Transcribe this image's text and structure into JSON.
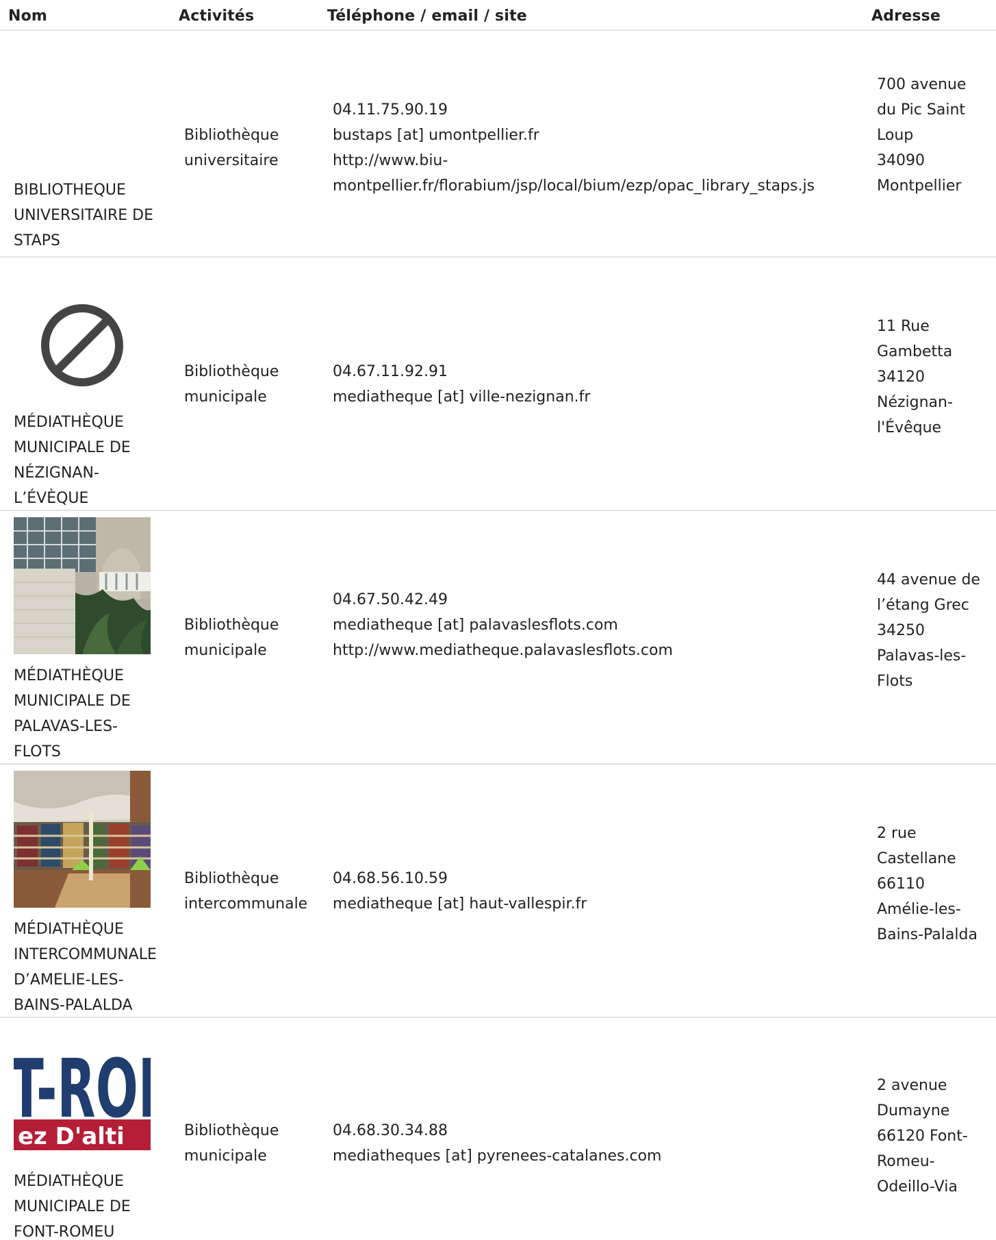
{
  "headers": {
    "nom": "Nom",
    "activites": "Activités",
    "contact": "Téléphone / email / site",
    "adresse": "Adresse"
  },
  "rows": [
    {
      "name_lines": [
        "BIBLIOTHEQUE",
        "UNIVERSITAIRE DE",
        "STAPS"
      ],
      "activity_lines": [
        "Bibliothèque",
        "universitaire"
      ],
      "contact_lines": [
        "04.11.75.90.19",
        "bustaps [at] umontpellier.fr",
        "http://www.biu-",
        "montpellier.fr/florabium/jsp/local/bium/ezp/opac_library_staps.js"
      ],
      "address_lines": [
        "700 avenue",
        "du Pic Saint",
        "Loup",
        "34090",
        "Montpellier"
      ],
      "image": "none"
    },
    {
      "name_lines": [
        "MÉDIATHÈQUE",
        "MUNICIPALE DE",
        "NÉZIGNAN-",
        "L’ÉVÈQUE"
      ],
      "activity_lines": [
        "Bibliothèque",
        "municipale"
      ],
      "contact_lines": [
        "04.67.11.92.91",
        "mediatheque [at] ville-nezignan.fr"
      ],
      "address_lines": [
        "11 Rue",
        "Gambetta",
        "34120",
        "Nézignan-",
        "l'Évêque"
      ],
      "image": "no-image-icon"
    },
    {
      "name_lines": [
        "MÉDIATHÈQUE",
        "MUNICIPALE DE",
        "PALAVAS-LES-",
        "FLOTS"
      ],
      "activity_lines": [
        "Bibliothèque",
        "municipale"
      ],
      "contact_lines": [
        "04.67.50.42.49",
        "mediatheque [at] palavaslesflots.com",
        "http://www.mediatheque.palavaslesflots.com"
      ],
      "address_lines": [
        "44 avenue de",
        "l’étang Grec",
        "34250",
        "Palavas-les-",
        "Flots"
      ],
      "image": "building-photo"
    },
    {
      "name_lines": [
        "MÉDIATHÈQUE",
        "INTERCOMMUNALE",
        "D’AMELIE-LES-",
        "BAINS-PALALDA"
      ],
      "activity_lines": [
        "Bibliothèque",
        "intercommunale"
      ],
      "contact_lines": [
        "04.68.56.10.59",
        "mediatheque [at] haut-vallespir.fr"
      ],
      "address_lines": [
        "2 rue",
        "Castellane",
        "66110",
        "Amélie-les-",
        "Bains-Palalda"
      ],
      "image": "library-interior-photo"
    },
    {
      "name_lines": [
        "MÉDIATHÈQUE",
        "MUNICIPALE DE",
        "FONT-ROMEU"
      ],
      "activity_lines": [
        "Bibliothèque",
        "municipale"
      ],
      "contact_lines": [
        "04.68.30.34.88",
        "mediatheques [at] pyrenees-catalanes.com"
      ],
      "address_lines": [
        "2 avenue",
        "Dumayne",
        "66120 Font-",
        "Romeu-",
        "Odeillo-Via"
      ],
      "image": "font-romeu-logo",
      "logo_text_top": "T-ROI",
      "logo_text_bottom": "ez D'alti"
    }
  ],
  "colors": {
    "divider": "#e2e2e2",
    "text": "#222222",
    "logo_blue": "#1f3d6e",
    "logo_red": "#b51f36"
  }
}
